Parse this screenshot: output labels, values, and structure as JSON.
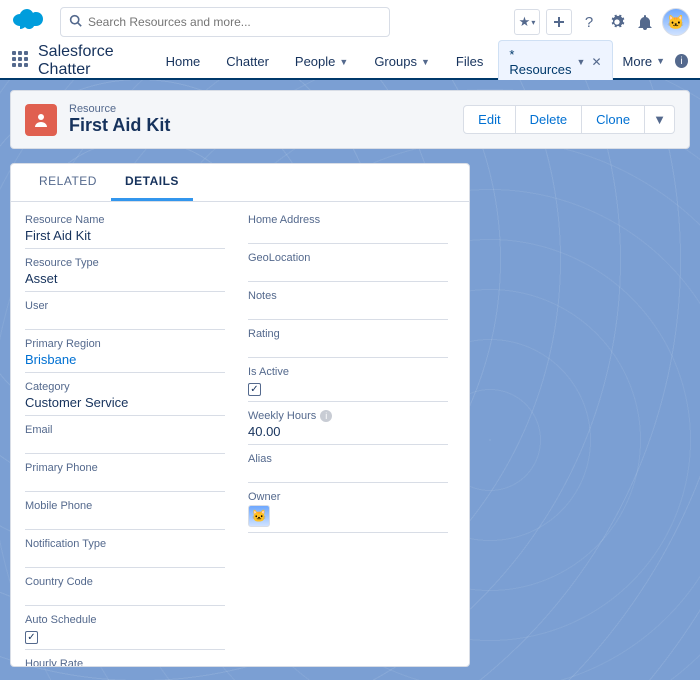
{
  "header": {
    "search_placeholder": "Search Resources and more..."
  },
  "nav": {
    "brand": "Salesforce Chatter",
    "tabs": {
      "home": "Home",
      "chatter": "Chatter",
      "people": "People",
      "groups": "Groups",
      "files": "Files",
      "resources": "* Resources"
    },
    "more": "More"
  },
  "record": {
    "object_label": "Resource",
    "title": "First Aid Kit",
    "actions": {
      "edit": "Edit",
      "delete": "Delete",
      "clone": "Clone"
    }
  },
  "card_tabs": {
    "related": "RELATED",
    "details": "DETAILS"
  },
  "fields": {
    "left": {
      "resource_name": {
        "label": "Resource Name",
        "value": "First Aid Kit"
      },
      "resource_type": {
        "label": "Resource Type",
        "value": "Asset"
      },
      "user": {
        "label": "User",
        "value": ""
      },
      "primary_region": {
        "label": "Primary Region",
        "value": "Brisbane"
      },
      "category": {
        "label": "Category",
        "value": "Customer Service"
      },
      "email": {
        "label": "Email",
        "value": ""
      },
      "primary_phone": {
        "label": "Primary Phone",
        "value": ""
      },
      "mobile_phone": {
        "label": "Mobile Phone",
        "value": ""
      },
      "notification_type": {
        "label": "Notification Type",
        "value": ""
      },
      "country_code": {
        "label": "Country Code",
        "value": ""
      },
      "auto_schedule": {
        "label": "Auto Schedule",
        "checked": true
      },
      "hourly_rate": {
        "label": "Hourly Rate",
        "value": ""
      }
    },
    "right": {
      "home_address": {
        "label": "Home Address",
        "value": ""
      },
      "geolocation": {
        "label": "GeoLocation",
        "value": ""
      },
      "notes": {
        "label": "Notes",
        "value": ""
      },
      "rating": {
        "label": "Rating",
        "value": ""
      },
      "is_active": {
        "label": "Is Active",
        "checked": true
      },
      "weekly_hours": {
        "label": "Weekly Hours",
        "value": "40.00"
      },
      "alias": {
        "label": "Alias",
        "value": ""
      },
      "owner": {
        "label": "Owner"
      }
    }
  }
}
